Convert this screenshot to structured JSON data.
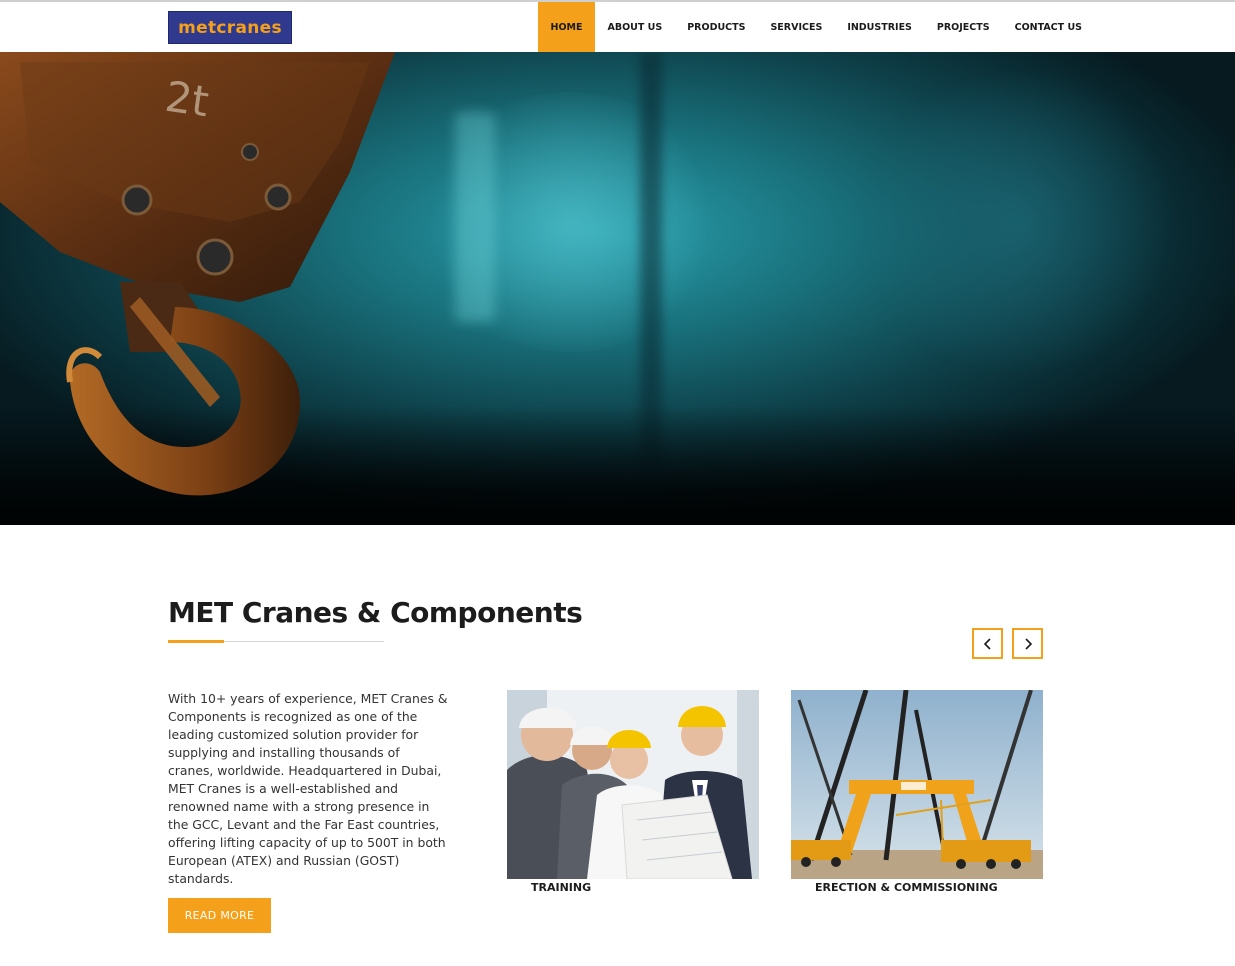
{
  "brand": {
    "logo_text": "metcranes",
    "accent": "#f5a01a",
    "logo_bg": "#2f3a8f"
  },
  "nav": {
    "items": [
      {
        "label": "HOME",
        "active": true
      },
      {
        "label": "ABOUT US",
        "active": false
      },
      {
        "label": "PRODUCTS",
        "active": false
      },
      {
        "label": "SERVICES",
        "active": false
      },
      {
        "label": "INDUSTRIES",
        "active": false
      },
      {
        "label": "PROJECTS",
        "active": false
      },
      {
        "label": "CONTACT US",
        "active": false
      }
    ]
  },
  "hero": {
    "image": "crane-hook-photo",
    "hook_marking": "2t",
    "slides": 6,
    "active_slide": 4
  },
  "section": {
    "title": "MET Cranes & Components",
    "intro": "With 10+ years of experience, MET Cranes & Components is recognized as one of the leading customized solution provider for supplying and installing thousands of cranes, worldwide. Headquartered in Dubai, MET Cranes is a well-established and renowned name with a strong presence in the GCC, Levant and the Far East countries, offering lifting capacity of up to 500T in both European (ATEX) and Russian (GOST) standards.",
    "read_more_label": "READ MORE",
    "prev_icon": "chevron-left-icon",
    "next_icon": "chevron-right-icon"
  },
  "services": [
    {
      "label": "TRAINING",
      "image": "engineers-in-hard-hats-photo"
    },
    {
      "label": "ERECTION & COMMISSIONING",
      "image": "gantry-crane-erection-photo"
    }
  ]
}
